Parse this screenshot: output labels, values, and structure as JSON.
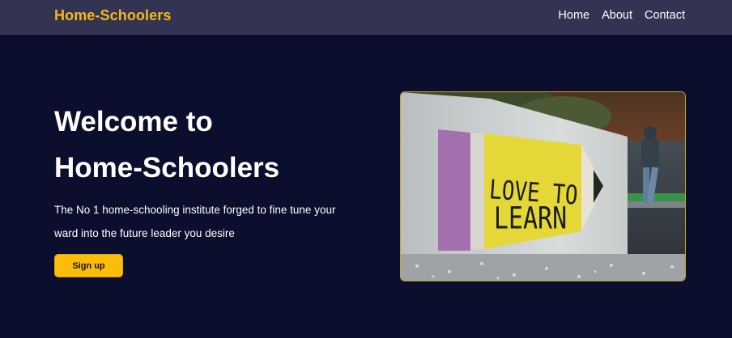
{
  "nav": {
    "brand": "Home-Schoolers",
    "links": [
      "Home",
      "About",
      "Contact"
    ]
  },
  "hero": {
    "title_line1": "Welcome to",
    "title_line2": "Home-Schoolers",
    "description": "The No 1 home-schooling institute forged to fine tune your ward into the future leader you desire",
    "cta_label": "Sign up",
    "image_text_line1": "LOVE TO",
    "image_text_line2": "LEARN"
  },
  "colors": {
    "background": "#0b0e2c",
    "navbar": "#323452",
    "brand": "#f5b81c",
    "button": "#fcbc0a",
    "image_border": "#c9a42a"
  }
}
